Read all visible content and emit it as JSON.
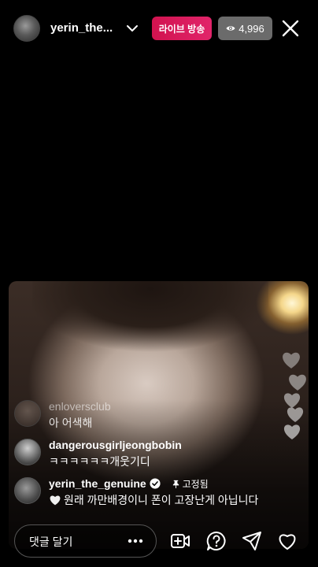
{
  "header": {
    "username": "yerin_the...",
    "live_label": "라이브 방송",
    "viewer_count": "4,996"
  },
  "comments": [
    {
      "username": "enloversclub",
      "text": "아 어색해"
    },
    {
      "username": "dangerousgirljeongbobin",
      "text": "ㅋㅋㅋㅋㅋㅋ개웃기디"
    },
    {
      "username": "yerin_the_genuine",
      "pinned_label": "고정됨",
      "text": "원래 까만배경이니 폰이 고장난게 아닙니다"
    }
  ],
  "bottom_bar": {
    "comment_placeholder": "댓글 달기"
  },
  "colors": {
    "live_badge": "#d1134f",
    "viewer_badge": "#6b6b6b",
    "verified": "#3897f0"
  },
  "icons": [
    "chevron-down-icon",
    "eye-icon",
    "close-icon",
    "verified-icon",
    "pin-icon",
    "heart-icon",
    "more-icon",
    "add-video-icon",
    "question-icon",
    "send-icon"
  ]
}
